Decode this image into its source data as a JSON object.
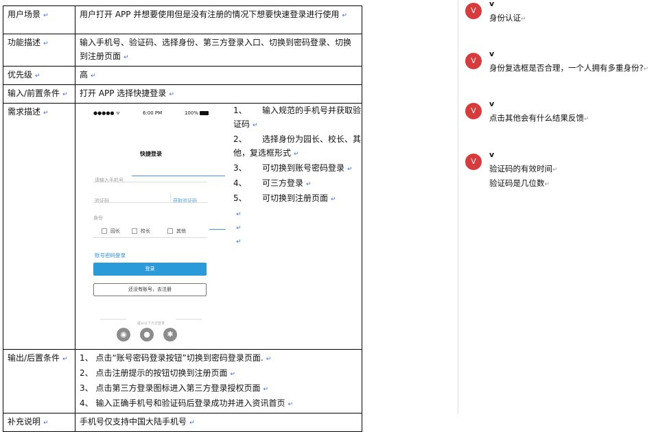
{
  "table": {
    "rows": [
      {
        "label": "用户场景",
        "content": "用户打开 APP 并想要使用但是没有注册的情况下想要快速登录进行使用"
      },
      {
        "label": "功能描述",
        "content": "输入手机号、验证码、选择身份、第三方登录入口、切换到密码登录、切换到注册页面"
      },
      {
        "label": "优先级",
        "content": "高"
      },
      {
        "label": "输入/前置条件",
        "content": "打开 APP 选择快捷登录"
      },
      {
        "label": "需求描述"
      },
      {
        "label": "输出/后置条件",
        "items": [
          "1、 点击“账号密码登录按钮”切换到密码登录页面.",
          "2、 点击注册提示的按钮切换到注册页面",
          "3、 点击第三方登录图标进入第三方登录授权页面",
          "4、 输入正确手机号和验证码后登录成功并进入资讯首页"
        ]
      },
      {
        "label": "补充说明",
        "content": "手机号仅支持中国大陆手机号"
      }
    ]
  },
  "phone": {
    "signal": "●●●●● ᯤ",
    "time": "6:00 PM",
    "battery_text": "100%",
    "title": "快捷登录",
    "phone_placeholder": "请输入手机号",
    "code_placeholder": "验证码",
    "get_code": "获取验证码",
    "identity_label": "身份",
    "roles": [
      "园长",
      "校长",
      "其他"
    ],
    "password_login": "账号密码登录",
    "login_button": "登录",
    "register_button": "还没有账号，去注册",
    "social_label": "或从以下方式登录"
  },
  "requirements": [
    {
      "num": "1、",
      "text": "输入规范的手机号并获取验证码"
    },
    {
      "num": "2、",
      "text": "选择身份为园长、校长、其他，复选框形式"
    },
    {
      "num": "3、",
      "text": "可切换到账号密码登录"
    },
    {
      "num": "4、",
      "text": "可三方登录"
    },
    {
      "num": "5、",
      "text": "可切换到注册页面"
    }
  ],
  "comments": [
    {
      "avatar": "V",
      "author": "v",
      "lines": [
        "身份认证"
      ]
    },
    {
      "avatar": "V",
      "author": "v",
      "lines": [
        "身份复选框是否合理，一个人拥有多重身份?"
      ]
    },
    {
      "avatar": "V",
      "author": "v",
      "lines": [
        "点击其他会有什么结果反馈"
      ]
    },
    {
      "avatar": "V",
      "author": "v",
      "lines": [
        "验证码的有效时间",
        "验证码是几位数"
      ]
    }
  ],
  "colors": {
    "accent": "#2a9ad8",
    "avatar": "#d83b3b",
    "link": "#2f8ed8"
  },
  "icons": [
    "weibo-icon",
    "qq-icon",
    "wechat-icon",
    "wifi-icon"
  ]
}
